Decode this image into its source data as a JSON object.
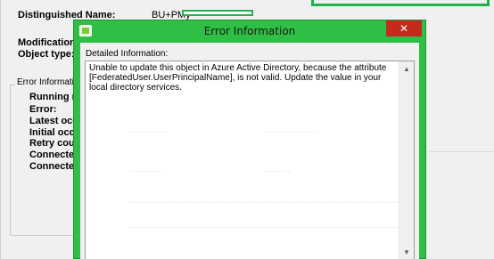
{
  "background_window": {
    "fields": {
      "distinguished_name_label": "Distinguished Name:",
      "distinguished_name_value": "BU+PMy",
      "modification_type_label": "Modification ty",
      "object_type_label": "Object type:"
    },
    "error_group": {
      "title": "Error Informati",
      "labels": [
        "Running ma",
        "Error:",
        "Latest occu",
        "Initial occu",
        "Retry count",
        "Connected",
        "Connected"
      ]
    }
  },
  "dialog": {
    "title": "Error Information",
    "close_glyph": "✕",
    "detail_label": "Detailed Information:",
    "detail_text": "Unable to update this object in Azure Active Directory, because the attribute [FederatedUser.UserPrincipalName], is not valid. Update the value in your local directory services.",
    "scroll_up_glyph": "▲",
    "scroll_down_glyph": "▼"
  },
  "colors": {
    "dialog_frame": "#2fbf45",
    "highlight_annotation": "#22b14c",
    "close_button": "#c42b1c"
  }
}
